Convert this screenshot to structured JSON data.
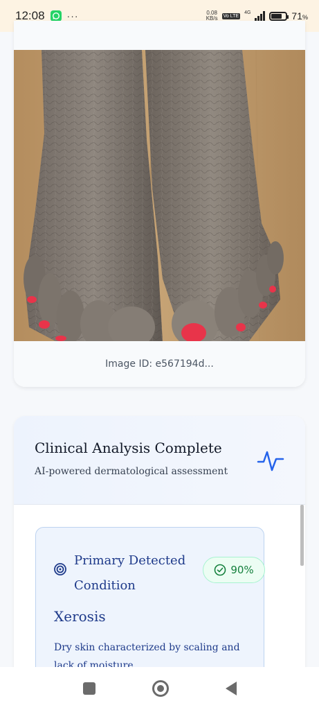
{
  "status_bar": {
    "time": "12:08",
    "more": "···",
    "net_speed_value": "0.08",
    "net_speed_unit": "KB/s",
    "volte": "Vo LTE",
    "network": "4G",
    "battery_percent": "71",
    "battery_symbol": "%",
    "battery_level": 0.71
  },
  "image_card": {
    "image_id": "Image ID: e567194d..."
  },
  "analysis": {
    "title": "Clinical Analysis Complete",
    "subtitle": "AI-powered dermatological assessment",
    "primary_label": "Primary Detected Condition",
    "confidence": "90%",
    "condition_name": "Xerosis",
    "condition_description": "Dry skin characterized by scaling and lack of moisture."
  },
  "colors": {
    "accent_blue": "#2563eb",
    "condition_text": "#1e3a8a",
    "confidence_green": "#15803d",
    "nail_red": "#e8344a"
  },
  "icons": [
    "whatsapp-icon",
    "pulse-icon",
    "target-icon",
    "check-circle-icon",
    "recents-icon",
    "home-icon",
    "back-icon"
  ]
}
